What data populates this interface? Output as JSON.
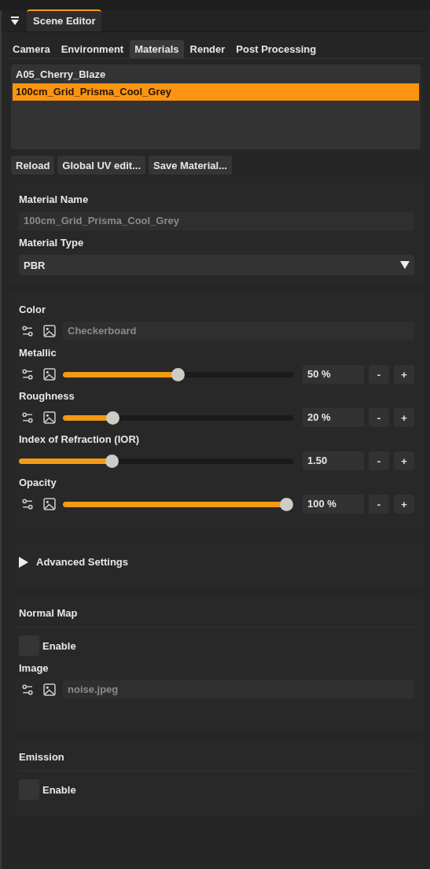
{
  "panel": {
    "title": "Scene Editor",
    "expanded": true
  },
  "tabs": [
    {
      "label": "Camera",
      "selected": false
    },
    {
      "label": "Environment",
      "selected": false
    },
    {
      "label": "Materials",
      "selected": true
    },
    {
      "label": "Render",
      "selected": false
    },
    {
      "label": "Post Processing",
      "selected": false
    }
  ],
  "materials": [
    {
      "name": "A05_Cherry_Blaze",
      "selected": false
    },
    {
      "name": "100cm_Grid_Prisma_Cool_Grey",
      "selected": true
    }
  ],
  "buttons": [
    "Reload",
    "Global UV edit...",
    "Save Material..."
  ],
  "material_name": {
    "label": "Material Name",
    "value": "100cm_Grid_Prisma_Cool_Grey"
  },
  "material_type": {
    "label": "Material Type",
    "value": "PBR"
  },
  "properties": [
    {
      "kind": "texture",
      "label": "Color",
      "value": "Checkerboard"
    },
    {
      "kind": "texture_slider",
      "label": "Metallic",
      "level": 0.5,
      "value": "50 %"
    },
    {
      "kind": "texture_slider",
      "label": "Roughness",
      "level": 0.2,
      "value": "20 %"
    },
    {
      "kind": "slider",
      "label": "Index of Refraction (IOR)",
      "level": 0.33,
      "value": "1.50"
    },
    {
      "kind": "texture_slider",
      "label": "Opacity",
      "level": 1.0,
      "value": "100 %"
    }
  ],
  "stepper": {
    "minus": "-",
    "plus": "+"
  },
  "advanced": {
    "label": "Advanced Settings",
    "expanded": false
  },
  "normal_map": {
    "title": "Normal Map",
    "enable": {
      "label": "Enable",
      "checked": false
    },
    "image": {
      "label": "Image",
      "value": "noise.jpeg"
    }
  },
  "emission": {
    "title": "Emission",
    "enable": {
      "label": "Enable",
      "checked": false
    }
  }
}
